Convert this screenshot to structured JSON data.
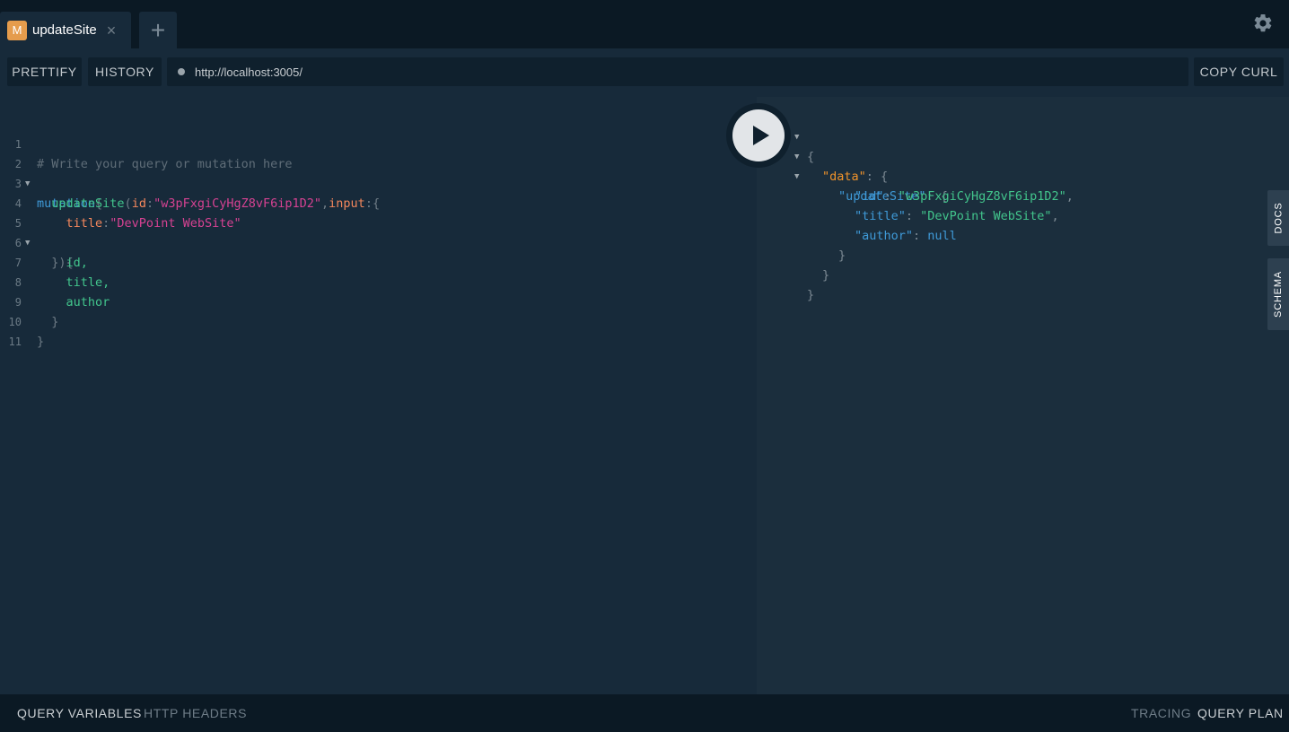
{
  "tabs": [
    {
      "badge": "M",
      "label": "updateSite",
      "close": "×"
    }
  ],
  "add_tab": "+",
  "toolbar": {
    "prettify": "PRETTIFY",
    "history": "HISTORY",
    "endpoint": "http://localhost:3005/",
    "copy_curl": "COPY CURL"
  },
  "editor": {
    "line_numbers": [
      "1",
      "2",
      "3",
      "4",
      "5",
      "6",
      "7",
      "8",
      "9",
      "10",
      "11"
    ],
    "comment": "# Write your query or mutation here",
    "keyword": "mutation",
    "brace_open": "{",
    "fn": "updateSite",
    "paren_open": "(",
    "arg_id": "id",
    "colon": ":",
    "id_value": "\"w3pFxgiCyHgZ8vF6ip1D2\"",
    "comma": ",",
    "arg_input": "input",
    "input_brace": "{",
    "arg_title": "title",
    "title_value": "\"DevPoint WebSite\"",
    "close_args": "}){",
    "field_id": "id,",
    "field_title": "title,",
    "field_author": "author",
    "close_inner": "}",
    "close_outer": "}"
  },
  "result": {
    "open": "{",
    "data_key": "\"data\"",
    "update_key": "\"updateSite\"",
    "id_key": "\"id\"",
    "id_value": "\"w3pFxgiCyHgZ8vF6ip1D2\"",
    "title_key": "\"title\"",
    "title_value": "\"DevPoint WebSite\"",
    "author_key": "\"author\"",
    "author_value": "null",
    "colon_brace": ": {",
    "colon": ": ",
    "comma": ",",
    "close": "}"
  },
  "side_tabs": {
    "docs": "DOCS",
    "schema": "SCHEMA"
  },
  "bottom": {
    "query_variables": "QUERY VARIABLES",
    "http_headers": "HTTP HEADERS",
    "tracing": "TRACING",
    "query_plan": "QUERY PLAN"
  },
  "icons": {
    "settings": "gear-icon",
    "run": "play-icon",
    "fold": "triangle-down-icon"
  },
  "colors": {
    "background": "#0f202d",
    "editor": "#172a3a",
    "result": "#1b2e3d",
    "badge": "#e59c4c"
  }
}
